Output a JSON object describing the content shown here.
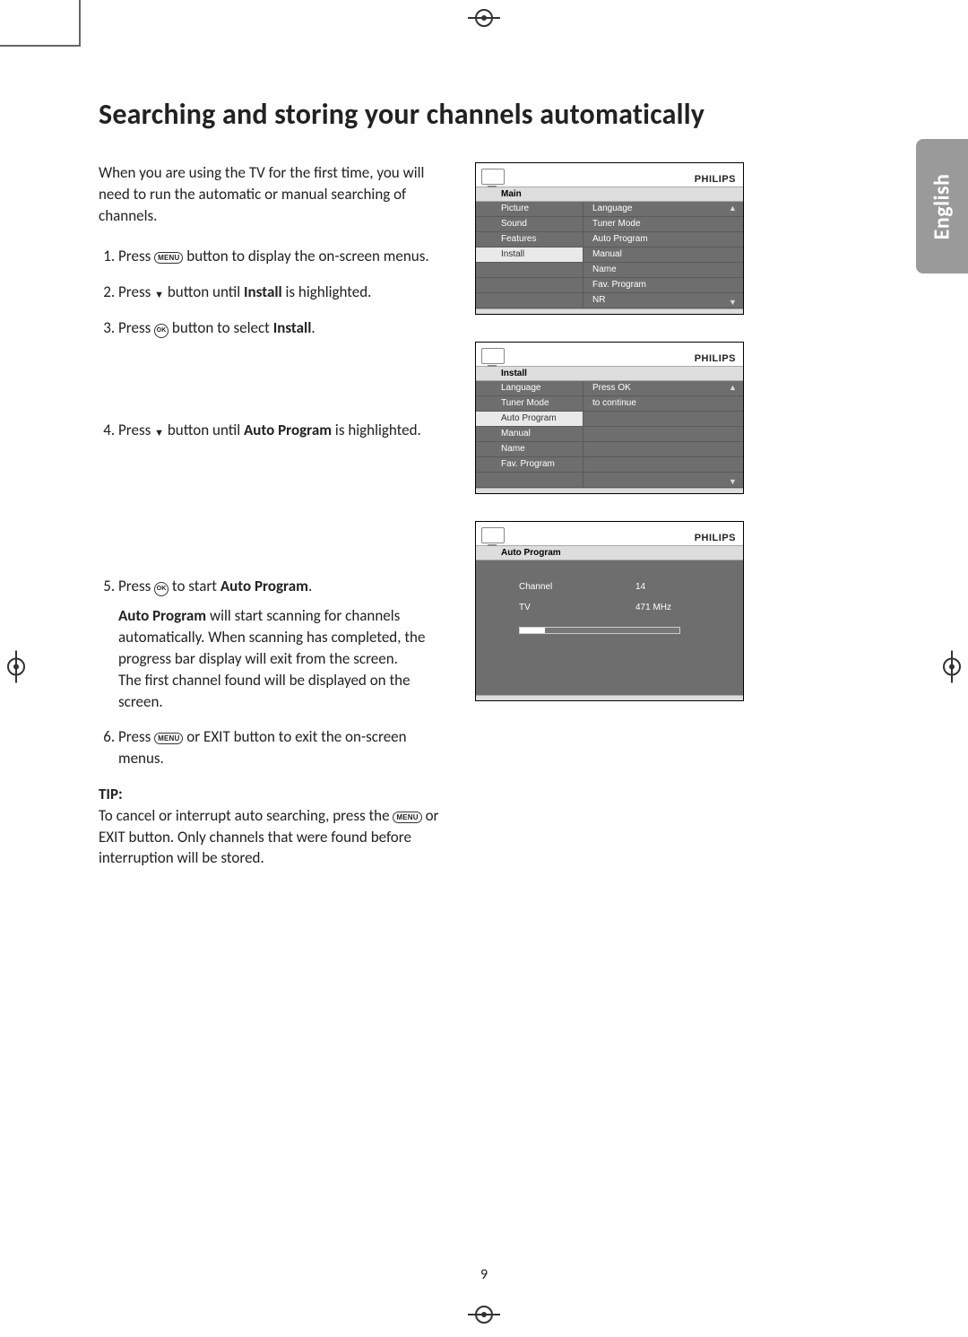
{
  "page_number": "9",
  "language_tab": "English",
  "title": "Searching and storing your channels automatically",
  "intro": "When you are using the TV for the first time, you will need to run the automatic or manual searching of channels.",
  "buttons": {
    "menu": "MENU",
    "ok": "OK"
  },
  "symbols": {
    "down": "▼"
  },
  "steps": {
    "s1_a": "Press ",
    "s1_b": " button to display the on-screen menus.",
    "s2_a": "Press ",
    "s2_b": " button until ",
    "s2_bold": "Install",
    "s2_c": " is highlighted.",
    "s3_a": "Press ",
    "s3_b": " button to select ",
    "s3_bold": "Install",
    "s3_c": ".",
    "s4_a": "Press ",
    "s4_b": " button until ",
    "s4_bold": "Auto Program",
    "s4_c": " is highlighted.",
    "s5_a": "Press ",
    "s5_b": " to start ",
    "s5_bold": "Auto Program",
    "s5_c": ".",
    "s5_p2a": "Auto Program",
    "s5_p2b": " will start scanning for channels automatically. When scanning has completed, the progress bar display will exit from the screen.",
    "s5_p3": "The first channel found will be displayed on the screen.",
    "s6_a": "Press ",
    "s6_b": " or EXIT button to exit the on-screen menus."
  },
  "tip_label": "TIP:",
  "tip_a": "To cancel or interrupt auto searching, press the ",
  "tip_b": " or EXIT button. Only channels that were found before interruption will be stored.",
  "osd_brand": "PHILIPS",
  "osd1": {
    "title": "Main",
    "left": [
      "Picture",
      "Sound",
      "Features",
      "Install"
    ],
    "right": [
      "Language",
      "Tuner Mode",
      "Auto Program",
      "Manual",
      "Name",
      "Fav. Program",
      "NR"
    ],
    "selected_left_index": 3
  },
  "osd2": {
    "title": "Install",
    "left": [
      "Language",
      "Tuner Mode",
      "Auto Program",
      "Manual",
      "Name",
      "Fav. Program"
    ],
    "right_line1": "Press OK",
    "right_line2": "to continue",
    "selected_left_index": 2
  },
  "osd3": {
    "title": "Auto Program",
    "rows": [
      {
        "k": "Channel",
        "v": "14"
      },
      {
        "k": "TV",
        "v": "471 MHz"
      }
    ],
    "progress_percent": 16
  }
}
